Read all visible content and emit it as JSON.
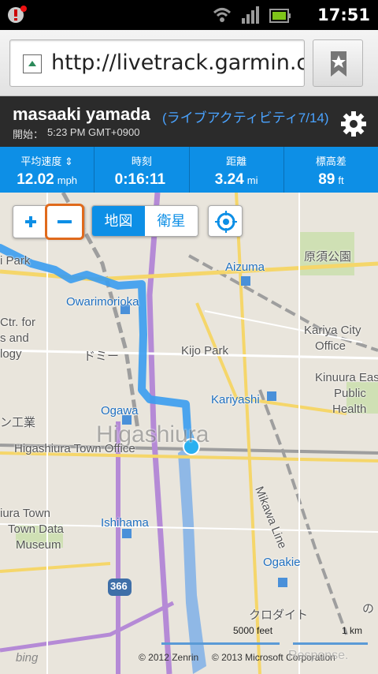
{
  "status": {
    "time": "17:51",
    "icons": [
      "alert-icon",
      "wifi-icon",
      "signal-icon",
      "battery-icon"
    ]
  },
  "browser": {
    "url": "http://livetrack.garmin.c...",
    "bookmark_icon": "bookmark-icon"
  },
  "header": {
    "name": "masaaki yamada",
    "activity": "(ライブアクティビティ7/14)",
    "start_label": "開始：",
    "start_time": "5:23 PM GMT+0900",
    "settings_icon": "gear-icon"
  },
  "stats": [
    {
      "label": "平均速度 ⇕",
      "value": "12.02",
      "unit": "mph"
    },
    {
      "label": "時刻",
      "value": "0:16:11",
      "unit": ""
    },
    {
      "label": "距離",
      "value": "3.24",
      "unit": "mi"
    },
    {
      "label": "標高差",
      "value": "89",
      "unit": "ft"
    }
  ],
  "map": {
    "controls": {
      "zoom_in": "+",
      "zoom_out": "−",
      "map_type_selected": "地図",
      "map_type_other": "衛星"
    },
    "labels": {
      "park": "i Park",
      "aizuma": "Aizuma",
      "harasuka": "原須公園",
      "owarimorioka": "Owarimorioka",
      "ctr_for": "Ctr. for",
      "s_and": "s and",
      "ology": "logy",
      "domy": "ドミー",
      "kariya_city": "Kariya City",
      "office": "Office",
      "kijo_park": "Kijo Park",
      "kinuura_eas": "Kinuura Eas",
      "public": "Public",
      "health": "Health",
      "kariyashi": "Kariyashi",
      "ogawa": "Ogawa",
      "kogyo": "ン工業",
      "higashiura": "Higashiura",
      "higashiura_office": "Higashiura Town Office",
      "mikawa_line": "Mikawa Line",
      "iura_town": "iura Town",
      "town_data": "Town Data",
      "museum": "Museum",
      "ishihama": "Ishihama",
      "ogakie": "Ogakie",
      "kurodaito": "クロダイト",
      "route": "366",
      "edge_right": "の"
    },
    "scale": {
      "feet": "5000 feet",
      "km": "1 km"
    },
    "copyright_zenrin": "© 2012 Zenrin",
    "copyright_ms": "© 2013 Microsoft Corporation",
    "watermark": "Response.",
    "brand": "bing"
  },
  "colors": {
    "accent": "#0d8fe6",
    "route": "#3a9cf0",
    "highlight": "#e06a1c",
    "header_bg": "#2b2b2b"
  }
}
